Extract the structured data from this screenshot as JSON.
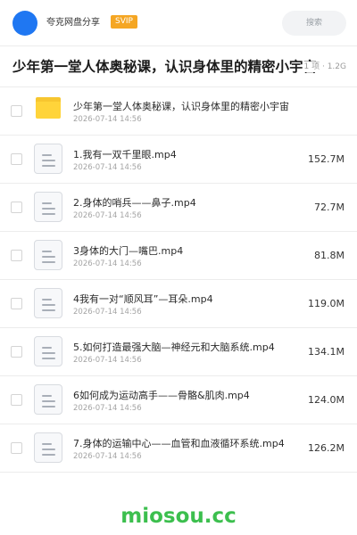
{
  "header": {
    "app_title": "夸克网盘分享",
    "badge": "SVIP",
    "search_placeholder": "搜索"
  },
  "share": {
    "title": "少年第一堂人体奥秘课，认识身体里的精密小宇宙",
    "meta": "1 项 · 1.2G"
  },
  "files": [
    {
      "name": "少年第一堂人体奥秘课，认识身体里的精密小宇宙",
      "date": "2026-07-14 14:56",
      "size": "",
      "icon": "folder-icon"
    },
    {
      "name": "1.我有一双千里眼.mp4",
      "date": "2026-07-14 14:56",
      "size": "152.7M",
      "icon": "video-file-icon"
    },
    {
      "name": "2.身体的哨兵——鼻子.mp4",
      "date": "2026-07-14 14:56",
      "size": "72.7M",
      "icon": "video-file-icon"
    },
    {
      "name": "3身体的大门—嘴巴.mp4",
      "date": "2026-07-14 14:56",
      "size": "81.8M",
      "icon": "video-file-icon"
    },
    {
      "name": "4我有一对“顺风耳”—耳朵.mp4",
      "date": "2026-07-14 14:56",
      "size": "119.0M",
      "icon": "video-file-icon"
    },
    {
      "name": "5.如何打造最强大脑—神经元和大脑系统.mp4",
      "date": "2026-07-14 14:56",
      "size": "134.1M",
      "icon": "video-file-icon"
    },
    {
      "name": "6如何成为运动高手——骨骼&肌肉.mp4",
      "date": "2026-07-14 14:56",
      "size": "124.0M",
      "icon": "video-file-icon"
    },
    {
      "name": "7.身体的运输中心——血管和血液循环系统.mp4",
      "date": "2026-07-14 14:56",
      "size": "126.2M",
      "icon": "video-file-icon"
    }
  ],
  "watermark": "miosou.cc"
}
